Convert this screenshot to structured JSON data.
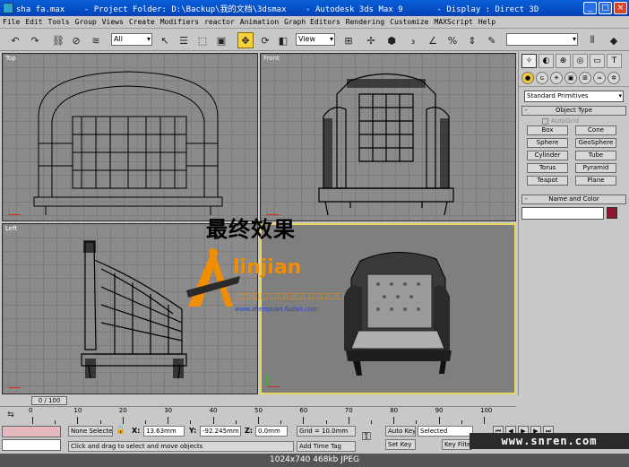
{
  "window": {
    "title": "sha fa.max    - Project Folder: D:\\Backup\\我的文档\\3dsmax    - Autodesk 3ds Max 9       - Display : Direct 3D",
    "min_label": "_",
    "max_label": "□",
    "close_label": "×"
  },
  "menu": [
    "File",
    "Edit",
    "Tools",
    "Group",
    "Views",
    "Create",
    "Modifiers",
    "reactor",
    "Animation",
    "Graph Editors",
    "Rendering",
    "Customize",
    "MAXScript",
    "Help"
  ],
  "toolbar": {
    "selection_filter": "All",
    "reference_coord": "View",
    "named_selection": ""
  },
  "viewports": {
    "top": "Top",
    "front": "Front",
    "left": "Left",
    "perspective": ""
  },
  "overlay": {
    "headline": "最终效果",
    "logo_text": "linjian",
    "logo_sub": "□□□□□□□□□□□□□",
    "logo_url": "www.zhenquan.fudan.com"
  },
  "command_panel": {
    "category": "Standard Primitives",
    "object_type_title": "Object Type",
    "autogrid": "AutoGrid",
    "buttons": [
      "Box",
      "Cone",
      "Sphere",
      "GeoSphere",
      "Cylinder",
      "Tube",
      "Torus",
      "Pyramid",
      "Teapot",
      "Plane"
    ],
    "name_color_title": "Name and Color",
    "object_color": "#8a1630"
  },
  "timeline": {
    "frame_display": "0 / 100",
    "ticks": [
      "0",
      "10",
      "20",
      "30",
      "40",
      "50",
      "60",
      "70",
      "80",
      "90",
      "100"
    ]
  },
  "status": {
    "selection": "None Selecte",
    "x_label": "X:",
    "x_value": "13.63mm",
    "y_label": "Y:",
    "y_value": "-92.245mm",
    "z_label": "Z:",
    "z_value": "0.0mm",
    "grid": "Grid = 10.0mm",
    "prompt": "Click and drag to select and move objects",
    "add_time_tag": "Add Time Tag",
    "auto_key": "Auto Key",
    "selected": "Selected",
    "set_key": "Set Key",
    "key_filters": "Key Filte"
  },
  "watermark": "www.snren.com",
  "caption": "1024x740  468kb  JPEG"
}
